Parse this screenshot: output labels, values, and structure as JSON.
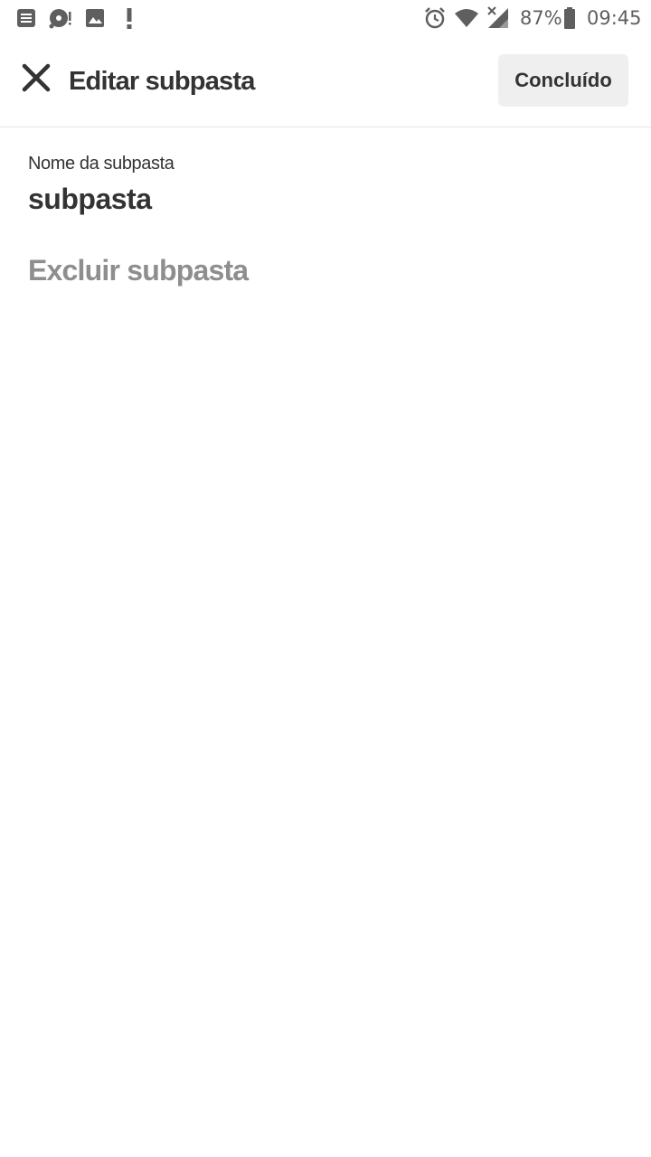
{
  "status_bar": {
    "notification_icons": [
      "notes-icon",
      "disc-alert-icon",
      "image-icon",
      "alert-icon"
    ],
    "alarm_icon": "alarm-icon",
    "wifi_icon": "wifi-icon",
    "signal_icon": "signal-no-service-icon",
    "battery_percent": "87%",
    "battery_level": 0.87,
    "time": "09:45"
  },
  "app_bar": {
    "close_icon": "close-icon",
    "title": "Editar subpasta",
    "done_label": "Concluído"
  },
  "form": {
    "name_label": "Nome da subpasta",
    "name_value": "subpasta",
    "delete_label": "Excluir subpasta"
  },
  "colors": {
    "text_primary": "#333333",
    "text_disabled": "#8e8e8e",
    "button_bg": "#efefef",
    "status_icon": "#5f5f5f",
    "background": "#ffffff"
  }
}
